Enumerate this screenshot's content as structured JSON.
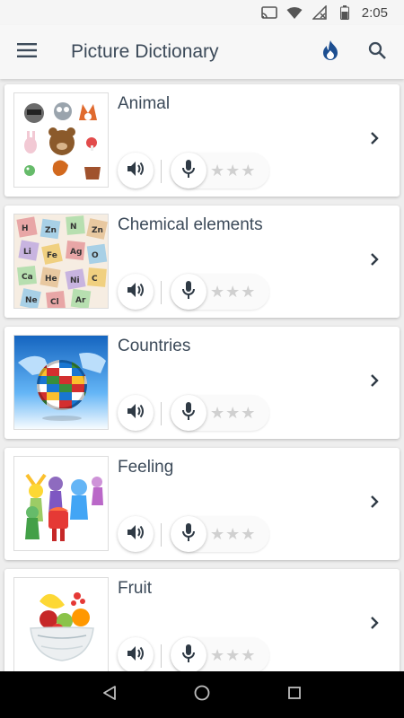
{
  "status_bar": {
    "time": "2:05",
    "icons": [
      "cast-icon",
      "wifi-icon",
      "no-signal-icon",
      "battery-icon"
    ]
  },
  "app_bar": {
    "title": "Picture Dictionary",
    "icons": [
      "menu-icon",
      "fire-icon",
      "search-icon"
    ]
  },
  "categories": [
    {
      "title": "Animal",
      "thumbnail": "animals-illustration",
      "rating": 0,
      "max_rating": 3
    },
    {
      "title": "Chemical elements",
      "thumbnail": "periodic-tiles-illustration",
      "rating": 0,
      "max_rating": 3
    },
    {
      "title": "Countries",
      "thumbnail": "flag-globe-illustration",
      "rating": 0,
      "max_rating": 3
    },
    {
      "title": "Feeling",
      "thumbnail": "emotion-characters-illustration",
      "rating": 0,
      "max_rating": 3
    },
    {
      "title": "Fruit",
      "thumbnail": "fruit-bowl-illustration",
      "rating": 0,
      "max_rating": 3
    }
  ],
  "colors": {
    "title_text": "#3c4a59",
    "accent": "#1d4f91",
    "star_empty": "#d0d0d0",
    "icon_dark": "#2f3a45"
  },
  "nav_bar": {
    "icons": [
      "back-icon",
      "home-icon",
      "recents-icon"
    ]
  }
}
